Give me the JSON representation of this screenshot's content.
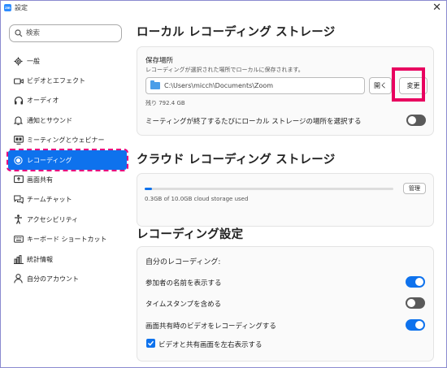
{
  "window": {
    "title": "設定",
    "app_icon_text": "zm"
  },
  "search": {
    "placeholder": "検索"
  },
  "sidebar": {
    "items": [
      {
        "label": "一般",
        "icon": "gear-icon"
      },
      {
        "label": "ビデオとエフェクト",
        "icon": "video-camera-icon"
      },
      {
        "label": "オーディオ",
        "icon": "headphones-icon"
      },
      {
        "label": "通知とサウンド",
        "icon": "bell-icon"
      },
      {
        "label": "ミーティングとウェビナー",
        "icon": "monitor-icon"
      },
      {
        "label": "レコーディング",
        "icon": "record-icon",
        "active": true
      },
      {
        "label": "画面共有",
        "icon": "share-screen-icon"
      },
      {
        "label": "チームチャット",
        "icon": "chat-icon"
      },
      {
        "label": "アクセシビリティ",
        "icon": "accessibility-icon"
      },
      {
        "label": "キーボード ショートカット",
        "icon": "keyboard-icon"
      },
      {
        "label": "統計情報",
        "icon": "statistics-icon"
      },
      {
        "label": "自分のアカウント",
        "icon": "account-icon"
      }
    ]
  },
  "local": {
    "heading": "ローカル レコーディング ストレージ",
    "location_label": "保存場所",
    "location_desc": "レコーディングが選択された場所でローカルに保存されます。",
    "path": "C:\\Users\\micch\\Documents\\Zoom",
    "open_button": "開く",
    "change_button": "変更",
    "remaining": "残り 792.4 GB",
    "choose_on_end_label": "ミーティングが終了するたびにローカル ストレージの場所を選択する",
    "choose_on_end": false
  },
  "cloud": {
    "heading": "クラウド レコーディング ストレージ",
    "usage_text": "0.3GB of 10.0GB cloud storage used",
    "usage_fraction": 0.03,
    "manage_button": "管理"
  },
  "recording_settings": {
    "heading": "レコーディング設定",
    "section_title": "自分のレコーディング:",
    "options": [
      {
        "label": "参加者の名前を表示する",
        "on": true
      },
      {
        "label": "タイムスタンプを含める",
        "on": false
      },
      {
        "label": "画面共有時のビデオをレコーディングする",
        "on": true
      }
    ],
    "sub_option": {
      "label": "ビデオと共有画面を左右表示する",
      "checked": true
    }
  },
  "colors": {
    "accent": "#0e72ed",
    "highlight": "#e8005f"
  }
}
